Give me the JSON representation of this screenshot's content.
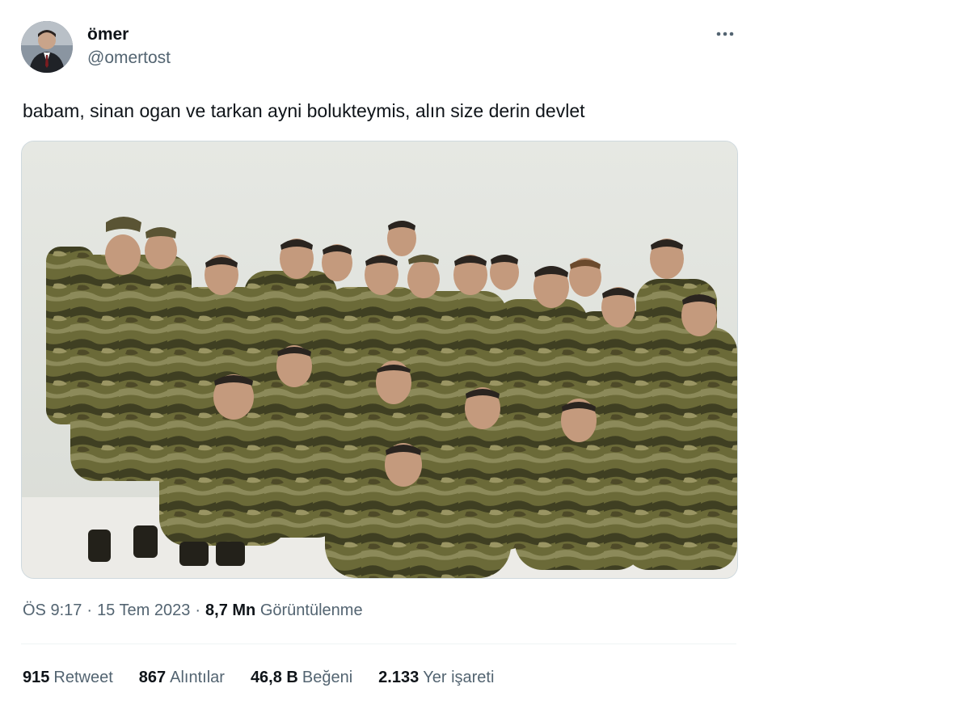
{
  "author": {
    "display_name": "ömer",
    "handle": "@omertost"
  },
  "tweet": {
    "text": "babam, sinan ogan ve tarkan ayni bolukteymis, alın size derin devlet"
  },
  "meta": {
    "time": "ÖS 9:17",
    "date": "15 Tem 2023",
    "views_count": "8,7 Mn",
    "views_label": "Görüntülenme"
  },
  "stats": [
    {
      "count": "915",
      "label": "Retweet"
    },
    {
      "count": "867",
      "label": "Alıntılar"
    },
    {
      "count": "46,8 B",
      "label": "Beğeni"
    },
    {
      "count": "2.133",
      "label": "Yer işareti"
    }
  ],
  "icons": {
    "more": "more-horizontal-icon"
  },
  "colors": {
    "primary_text": "#0f1419",
    "secondary_text": "#536471",
    "border": "#cfd9de",
    "camouflage": [
      "#5b5a2e",
      "#7a7440",
      "#3f3f22",
      "#8c8a5a"
    ]
  }
}
